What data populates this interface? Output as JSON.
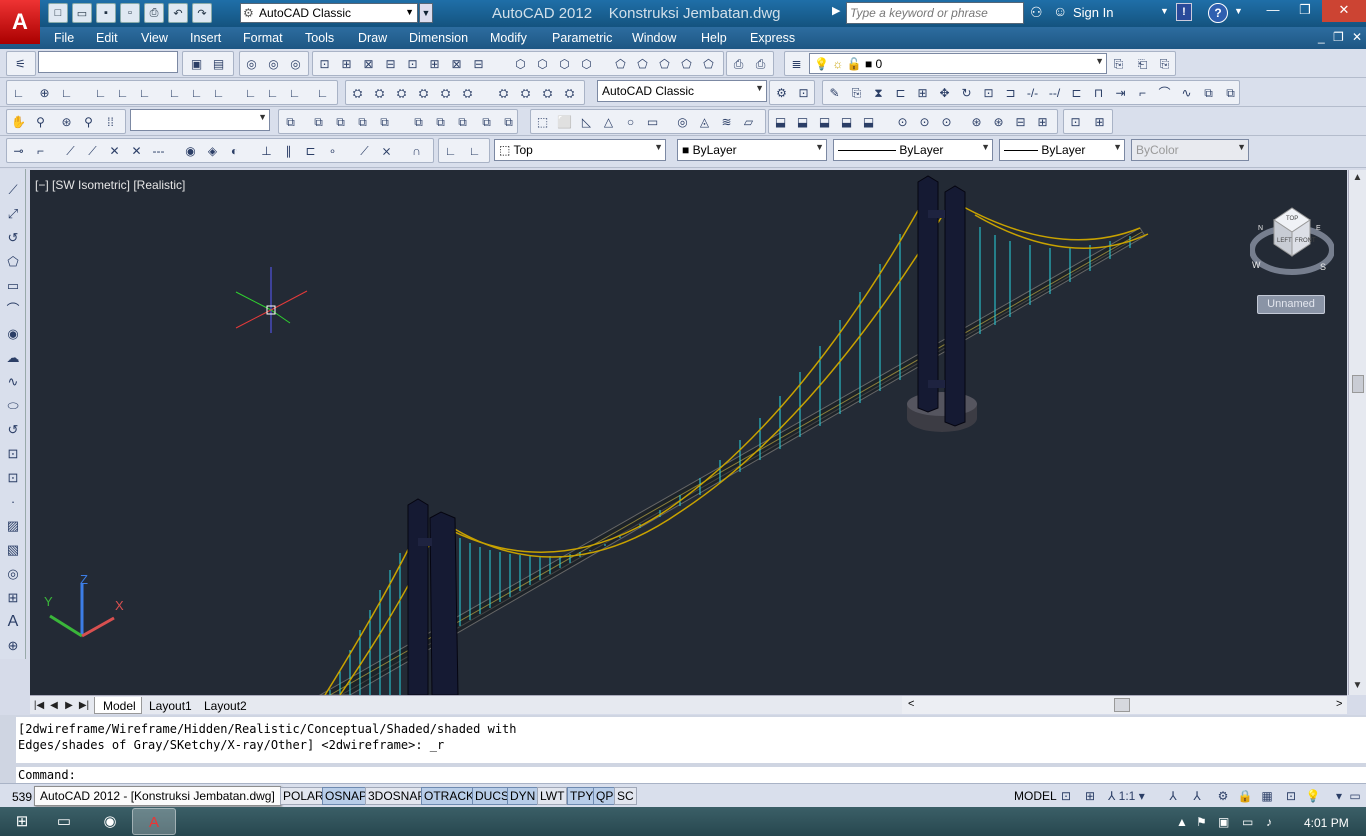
{
  "window": {
    "app_title": "AutoCAD 2012",
    "file_title": "Konstruksi Jembatan.dwg",
    "workspace": "AutoCAD Classic",
    "search_placeholder": "Type a keyword or phrase",
    "sign_in": "Sign In"
  },
  "menu": {
    "items": [
      "File",
      "Edit",
      "View",
      "Insert",
      "Format",
      "Tools",
      "Draw",
      "Dimension",
      "Modify",
      "Parametric",
      "Window",
      "Help",
      "Express"
    ]
  },
  "toolbars": {
    "layer_value": "0",
    "workspace_combo": "AutoCAD Classic",
    "view_combo": "Top",
    "color_combo": "ByLayer",
    "linetype_combo": "ByLayer",
    "lineweight_combo": "ByLayer",
    "plotstyle_combo": "ByColor"
  },
  "viewport": {
    "label": "[−] [SW Isometric] [Realistic]",
    "viewcube_unnamed": "Unnamed",
    "viewcube_faces": {
      "top": "TOP",
      "left": "LEFT",
      "front": "FRONT"
    },
    "compass": {
      "n": "N",
      "w": "W",
      "s": "S",
      "e": "E"
    },
    "ucs": {
      "x": "X",
      "y": "Y",
      "z": "Z"
    }
  },
  "tabs": {
    "model": "Model",
    "layout1": "Layout1",
    "layout2": "Layout2"
  },
  "command": {
    "history_line1": "[2dwireframe/Wireframe/Hidden/Realistic/Conceptual/Shaded/shaded with",
    "history_line2": "Edges/shades of Gray/SKetchy/X-ray/Other] <2dwireframe>: _r",
    "prompt": "Command:"
  },
  "status": {
    "coord_prefix": "539",
    "tooltip": "AutoCAD 2012 - [Konstruksi Jembatan.dwg]",
    "toggles": [
      {
        "label": "POLAR",
        "on": false
      },
      {
        "label": "OSNAP",
        "on": true
      },
      {
        "label": "3DOSNAP",
        "on": false
      },
      {
        "label": "OTRACK",
        "on": true
      },
      {
        "label": "DUCS",
        "on": true
      },
      {
        "label": "DYN",
        "on": true
      },
      {
        "label": "LWT",
        "on": false
      },
      {
        "label": "TPY",
        "on": true
      },
      {
        "label": "QP",
        "on": true
      },
      {
        "label": "SC",
        "on": false
      }
    ],
    "model": "MODEL",
    "scale": "1:1"
  },
  "taskbar": {
    "time": "4:01 PM"
  },
  "colors": {
    "viewport_bg": "#232a35",
    "titlebar": "#1f6fa8",
    "cable": "#c8a200",
    "hanger": "#27d4e0",
    "tower": "#151a33"
  }
}
